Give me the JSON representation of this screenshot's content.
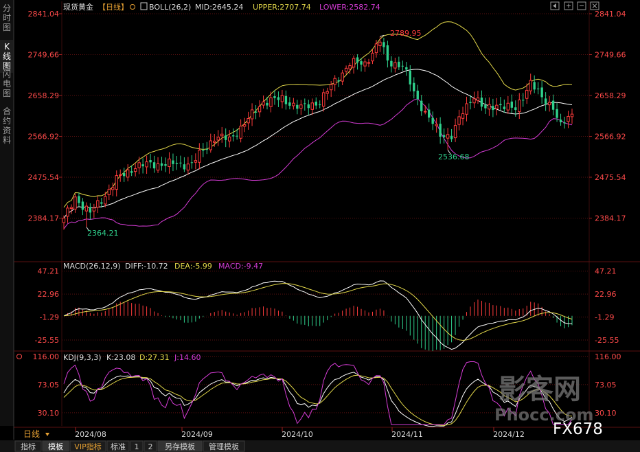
{
  "sidebar_tabs": [
    "分时图",
    "K线图",
    "闪电图",
    "合约资料"
  ],
  "toolbar_icons": [
    "prev-icon",
    "zoom-in-icon",
    "zoom-out-icon",
    "close-icon"
  ],
  "price_panel": {
    "name": "现货黄金",
    "period_tag": "【日线】",
    "indicator": "BOLL(26,2)",
    "mid_label": "MID:2645.24",
    "upper_label": "UPPER:2707.74",
    "lower_label": "LOWER:2582.74",
    "high_mark": "2789.95",
    "low_mark": "2364.21",
    "mid_low_mark": "2536.68",
    "y_ticks": [
      "2841.04",
      "2749.66",
      "2658.29",
      "2566.92",
      "2475.54",
      "2384.17"
    ],
    "colors": {
      "up": "#ff3c3c",
      "down": "#2fd08c",
      "upper": "#e3d84a",
      "mid": "#ffffff",
      "lower": "#d63cd6"
    }
  },
  "macd_panel": {
    "title": "MACD(26,12,9)",
    "diff_label": "DIFF:-10.72",
    "dea_label": "DEA:-5.99",
    "macd_label": "MACD:-9.47",
    "y_ticks": [
      "47.21",
      "22.96",
      "-1.29",
      "-25.55"
    ]
  },
  "kdj_panel": {
    "title": "KDJ(9,3,3)",
    "k_label": "K:23.08",
    "d_label": "D:27.31",
    "j_label": "J:14.60",
    "y_ticks": [
      "116.00",
      "73.05",
      "30.10"
    ]
  },
  "x_axis": {
    "period_button": "日线",
    "labels": [
      "2024/08",
      "2024/09",
      "2024/10",
      "2024/11",
      "2024/12"
    ]
  },
  "bottom_tabs": [
    "指标",
    "模板",
    "VIP指标",
    "标准",
    "1",
    "2",
    "另存模板",
    "管理模板"
  ],
  "watermark": {
    "brand": "影客网",
    "code": "FX678",
    "url": "Phocc.com"
  },
  "chart_data": {
    "type": "candlestick",
    "title": "现货黄金 日线",
    "x_labels": [
      "2024/08",
      "2024/09",
      "2024/10",
      "2024/11",
      "2024/12"
    ],
    "ylim": [
      2350,
      2841.04
    ],
    "price_anchors": [
      {
        "i": 0,
        "close": 2380
      },
      {
        "i": 3,
        "close": 2430
      },
      {
        "i": 7,
        "close": 2395
      },
      {
        "i": 10,
        "close": 2425
      },
      {
        "i": 14,
        "close": 2470
      },
      {
        "i": 19,
        "close": 2500
      },
      {
        "i": 24,
        "close": 2505
      },
      {
        "i": 29,
        "close": 2505
      },
      {
        "i": 34,
        "close": 2505
      },
      {
        "i": 40,
        "close": 2565
      },
      {
        "i": 44,
        "close": 2560
      },
      {
        "i": 48,
        "close": 2595
      },
      {
        "i": 53,
        "close": 2645
      },
      {
        "i": 58,
        "close": 2650
      },
      {
        "i": 63,
        "close": 2630
      },
      {
        "i": 68,
        "close": 2645
      },
      {
        "i": 72,
        "close": 2690
      },
      {
        "i": 76,
        "close": 2730
      },
      {
        "i": 80,
        "close": 2730
      },
      {
        "i": 84,
        "close": 2780
      },
      {
        "i": 86,
        "close": 2735
      },
      {
        "i": 90,
        "close": 2725
      },
      {
        "i": 93,
        "close": 2665
      },
      {
        "i": 96,
        "close": 2620
      },
      {
        "i": 100,
        "close": 2570
      },
      {
        "i": 103,
        "close": 2570
      },
      {
        "i": 106,
        "close": 2620
      },
      {
        "i": 109,
        "close": 2660
      },
      {
        "i": 112,
        "close": 2625
      },
      {
        "i": 116,
        "close": 2640
      },
      {
        "i": 120,
        "close": 2625
      },
      {
        "i": 124,
        "close": 2690
      },
      {
        "i": 127,
        "close": 2650
      },
      {
        "i": 130,
        "close": 2635
      },
      {
        "i": 132,
        "close": 2590
      },
      {
        "i": 135,
        "close": 2613
      }
    ],
    "extremes": [
      {
        "i": 6,
        "low": 2364.21
      },
      {
        "i": 84,
        "high": 2789.95
      },
      {
        "i": 102,
        "low": 2536.68
      }
    ],
    "macd_ylim": [
      -35,
      55
    ],
    "kdj_ylim": [
      10,
      120
    ]
  }
}
